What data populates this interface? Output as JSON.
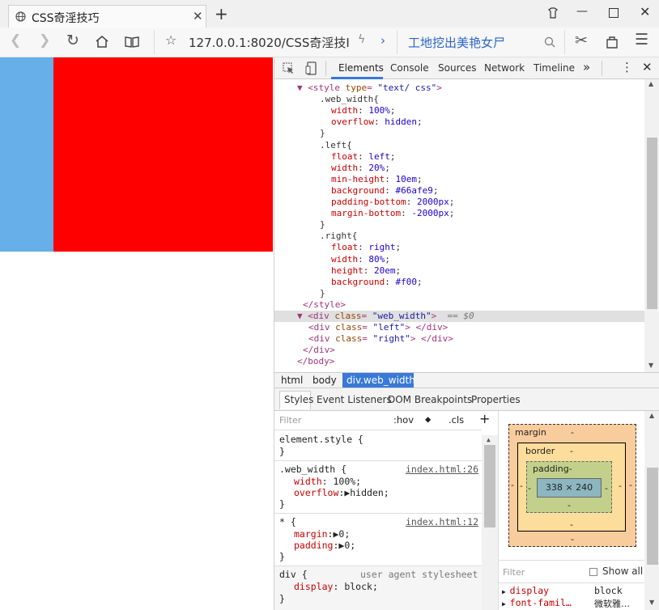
{
  "browser": {
    "tab_title": "CSS奇淫技巧",
    "new_tab": "+",
    "url": "127.0.0.1:8020/CSS奇淫技I",
    "search_text": "工地挖出美艳女尸",
    "window_controls": [
      "minimize",
      "maximize",
      "close"
    ]
  },
  "devtools": {
    "tabs": [
      "Elements",
      "Console",
      "Sources",
      "Network",
      "Timeline"
    ],
    "more": "»",
    "code_lines": [
      {
        "indent": 2,
        "parts": [
          [
            "tag",
            "▼ <style "
          ],
          [
            "attr",
            "type"
          ],
          [
            "tag",
            "= "
          ],
          [
            "val",
            "\"text/ css\""
          ],
          [
            "tag",
            ">"
          ]
        ]
      },
      {
        "indent": 6,
        "parts": [
          [
            "plain",
            ".web_width{"
          ]
        ]
      },
      {
        "indent": 8,
        "parts": [
          [
            "prop",
            "width"
          ],
          [
            "plain",
            ": "
          ],
          [
            "num",
            "100%"
          ],
          [
            "plain",
            ";"
          ]
        ]
      },
      {
        "indent": 8,
        "parts": [
          [
            "prop",
            "overflow"
          ],
          [
            "plain",
            ": "
          ],
          [
            "num",
            "hidden"
          ],
          [
            "plain",
            ";"
          ]
        ]
      },
      {
        "indent": 6,
        "parts": [
          [
            "plain",
            "}"
          ]
        ]
      },
      {
        "indent": 6,
        "parts": [
          [
            "plain",
            ".left{"
          ]
        ]
      },
      {
        "indent": 8,
        "parts": [
          [
            "prop",
            "float"
          ],
          [
            "plain",
            ": "
          ],
          [
            "num",
            "left"
          ],
          [
            "plain",
            ";"
          ]
        ]
      },
      {
        "indent": 8,
        "parts": [
          [
            "prop",
            "width"
          ],
          [
            "plain",
            ": "
          ],
          [
            "num",
            "20%"
          ],
          [
            "plain",
            ";"
          ]
        ]
      },
      {
        "indent": 8,
        "parts": [
          [
            "prop",
            "min-height"
          ],
          [
            "plain",
            ": "
          ],
          [
            "num",
            "10em"
          ],
          [
            "plain",
            ";"
          ]
        ]
      },
      {
        "indent": 8,
        "parts": [
          [
            "prop",
            "background"
          ],
          [
            "plain",
            ": "
          ],
          [
            "num",
            "#66afe9"
          ],
          [
            "plain",
            ";"
          ]
        ]
      },
      {
        "indent": 8,
        "parts": [
          [
            "prop",
            "padding-bottom"
          ],
          [
            "plain",
            ": "
          ],
          [
            "num",
            "2000px"
          ],
          [
            "plain",
            ";"
          ]
        ]
      },
      {
        "indent": 8,
        "parts": [
          [
            "prop",
            "margin-bottom"
          ],
          [
            "plain",
            ": "
          ],
          [
            "num",
            "-2000px"
          ],
          [
            "plain",
            ";"
          ]
        ]
      },
      {
        "indent": 6,
        "parts": [
          [
            "plain",
            "}"
          ]
        ]
      },
      {
        "indent": 6,
        "parts": [
          [
            "plain",
            ".right{"
          ]
        ]
      },
      {
        "indent": 8,
        "parts": [
          [
            "prop",
            "float"
          ],
          [
            "plain",
            ": "
          ],
          [
            "num",
            "right"
          ],
          [
            "plain",
            ";"
          ]
        ]
      },
      {
        "indent": 8,
        "parts": [
          [
            "prop",
            "width"
          ],
          [
            "plain",
            ": "
          ],
          [
            "num",
            "80%"
          ],
          [
            "plain",
            ";"
          ]
        ]
      },
      {
        "indent": 8,
        "parts": [
          [
            "prop",
            "height"
          ],
          [
            "plain",
            ": "
          ],
          [
            "num",
            "20em"
          ],
          [
            "plain",
            ";"
          ]
        ]
      },
      {
        "indent": 8,
        "parts": [
          [
            "prop",
            "background"
          ],
          [
            "plain",
            ": "
          ],
          [
            "num",
            "#f00"
          ],
          [
            "plain",
            ";"
          ]
        ]
      },
      {
        "indent": 6,
        "parts": [
          [
            "plain",
            "}"
          ]
        ]
      },
      {
        "indent": 3,
        "parts": [
          [
            "tag",
            "</style>"
          ]
        ]
      },
      {
        "indent": 2,
        "selected": true,
        "parts": [
          [
            "tag",
            "▼ <div "
          ],
          [
            "attr",
            "class"
          ],
          [
            "tag",
            "= "
          ],
          [
            "val",
            "\"web_width\""
          ],
          [
            "tag",
            ">"
          ],
          [
            "cmt",
            "  == $0"
          ]
        ]
      },
      {
        "indent": 4,
        "parts": [
          [
            "tag",
            "<div "
          ],
          [
            "attr",
            "class"
          ],
          [
            "tag",
            "= "
          ],
          [
            "val",
            "\"left\""
          ],
          [
            "tag",
            "> </div>"
          ]
        ]
      },
      {
        "indent": 4,
        "parts": [
          [
            "tag",
            "<div "
          ],
          [
            "attr",
            "class"
          ],
          [
            "tag",
            "= "
          ],
          [
            "val",
            "\"right\""
          ],
          [
            "tag",
            "> </div>"
          ]
        ]
      },
      {
        "indent": 3,
        "parts": [
          [
            "tag",
            "</div>"
          ]
        ]
      },
      {
        "indent": 2,
        "parts": [
          [
            "tag",
            "</body>"
          ]
        ]
      }
    ],
    "breadcrumbs": [
      "html",
      "body",
      "div.web_width"
    ],
    "sub_tabs": [
      "Styles",
      "Event Listeners",
      "DOM Breakpoints",
      "Properties"
    ],
    "styles": {
      "filter_placeholder": "Filter",
      "hov": ":hov",
      "cls": ".cls",
      "plus": "+",
      "element_style": "element.style {",
      "close_brace": "}",
      "rule1_selector": ".web_width {",
      "rule1_link": "index.html:26",
      "rule1_props": [
        [
          "width",
          "100%;"
        ],
        [
          "overflow",
          "▶hidden;"
        ]
      ],
      "rule2_selector": "* {",
      "rule2_link": "index.html:12",
      "rule2_props": [
        [
          "margin",
          "▶0;"
        ],
        [
          "padding",
          "▶0;"
        ]
      ],
      "rule3_selector": "div {",
      "rule3_source": "user agent stylesheet",
      "rule3_props": [
        [
          "display",
          "block;"
        ]
      ]
    },
    "box_model": {
      "margin_label": "margin",
      "border_label": "border",
      "padding_label": "padding-",
      "content": "338 × 240",
      "dash": "-"
    },
    "computed": {
      "filter_placeholder": "Filter",
      "show_all": "Show all",
      "rows": [
        [
          "display",
          "block"
        ],
        [
          "font-famil…",
          "微软雅…"
        ]
      ]
    }
  },
  "colors": {
    "left_box": "#66afe9",
    "right_box": "#ff0000",
    "selection": "#3879d9"
  }
}
